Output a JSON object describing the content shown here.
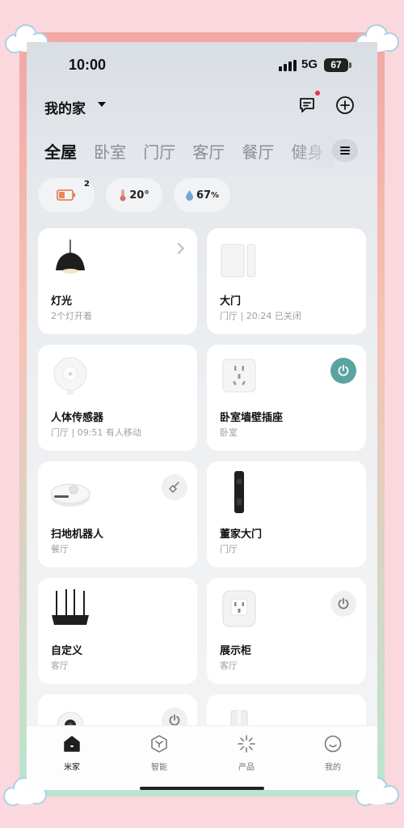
{
  "status_bar": {
    "time": "10:00",
    "network": "5G",
    "battery": "67"
  },
  "header": {
    "home_name": "我的家",
    "message_icon": "message-icon",
    "add_icon": "add-icon"
  },
  "tabs": [
    "全屋",
    "卧室",
    "门厅",
    "客厅",
    "餐厅",
    "健身"
  ],
  "active_tab": "全屋",
  "chips": {
    "battery_badge": "2",
    "temperature": "20°",
    "humidity_value": "67",
    "humidity_unit": "%"
  },
  "devices": [
    {
      "name": "灯光",
      "sub": "2个灯开着",
      "icon": "pendant-lamp-icon",
      "action": "chevron"
    },
    {
      "name": "大门",
      "sub": "门厅 | 20:24 已关闭",
      "icon": "door-sensor-icon",
      "action": "none"
    },
    {
      "name": "人体传感器",
      "sub": "门厅 | 09:51 有人移动",
      "icon": "motion-sensor-icon",
      "action": "none"
    },
    {
      "name": "卧室墙壁插座",
      "sub": "卧室",
      "icon": "wall-socket-icon",
      "action": "power-on"
    },
    {
      "name": "扫地机器人",
      "sub": "餐厅",
      "icon": "robot-vacuum-icon",
      "action": "sweep"
    },
    {
      "name": "董家大门",
      "sub": "门厅",
      "icon": "smart-lock-icon",
      "action": "none"
    },
    {
      "name": "自定义",
      "sub": "客厅",
      "icon": "router-icon",
      "action": "none"
    },
    {
      "name": "展示柜",
      "sub": "客厅",
      "icon": "plug-icon",
      "action": "power"
    },
    {
      "name": "",
      "sub": "",
      "icon": "camera-icon",
      "action": "power"
    },
    {
      "name": "",
      "sub": "",
      "icon": "speaker-icon",
      "action": "none"
    }
  ],
  "bottom_nav": [
    {
      "label": "米家",
      "icon": "home-icon",
      "active": true
    },
    {
      "label": "智能",
      "icon": "smart-cube-icon",
      "active": false
    },
    {
      "label": "产品",
      "icon": "product-sparkle-icon",
      "active": false
    },
    {
      "label": "我的",
      "icon": "profile-icon",
      "active": false
    }
  ],
  "colors": {
    "accent": "#5aa3a0",
    "frame_pink": "#fbd7de",
    "notification": "#e0344a"
  }
}
